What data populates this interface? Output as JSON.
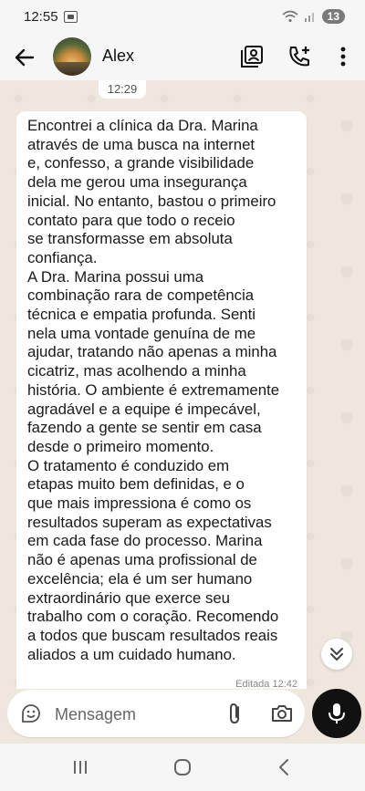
{
  "status_bar": {
    "time": "12:55",
    "battery": "13"
  },
  "header": {
    "contact_name": "Alex"
  },
  "chat": {
    "date_divider": "12:29",
    "message": {
      "text": "Encontrei a clínica da Dra. Marina\natravés de uma busca na internet\ne, confesso, a grande visibilidade\ndela me gerou uma insegurança\ninicial. No entanto, bastou o primeiro\ncontato para que todo o receio\nse transformasse em absoluta\nconfiança.\nA Dra. Marina possui uma\ncombinação rara de competência\ntécnica e empatia profunda. Senti\nnela uma vontade genuína de me\najudar, tratando não apenas a minha\ncicatriz, mas acolhendo a minha\nhistória. O ambiente é extremamente\nagradável e a equipe é impecável,\nfazendo a gente se sentir em casa\ndesde o primeiro momento.\nO tratamento é conduzido em\netapas muito bem definidas, e o\nque mais impressiona é como os\nresultados superam as expectativas\nem cada fase do processo. Marina\nnão é apenas uma profissional de\nexcelência; ela é um ser humano\nextraordinário que exerce seu\ntrabalho com o coração. Recomendo\na todos que buscam resultados reais\naliados a um cuidado humano.",
      "meta": "Editada 12:42"
    }
  },
  "composer": {
    "placeholder": "Mensagem"
  },
  "colors": {
    "background": "#efe7dd",
    "bubble": "#ffffff",
    "mic_button": "#111111"
  }
}
